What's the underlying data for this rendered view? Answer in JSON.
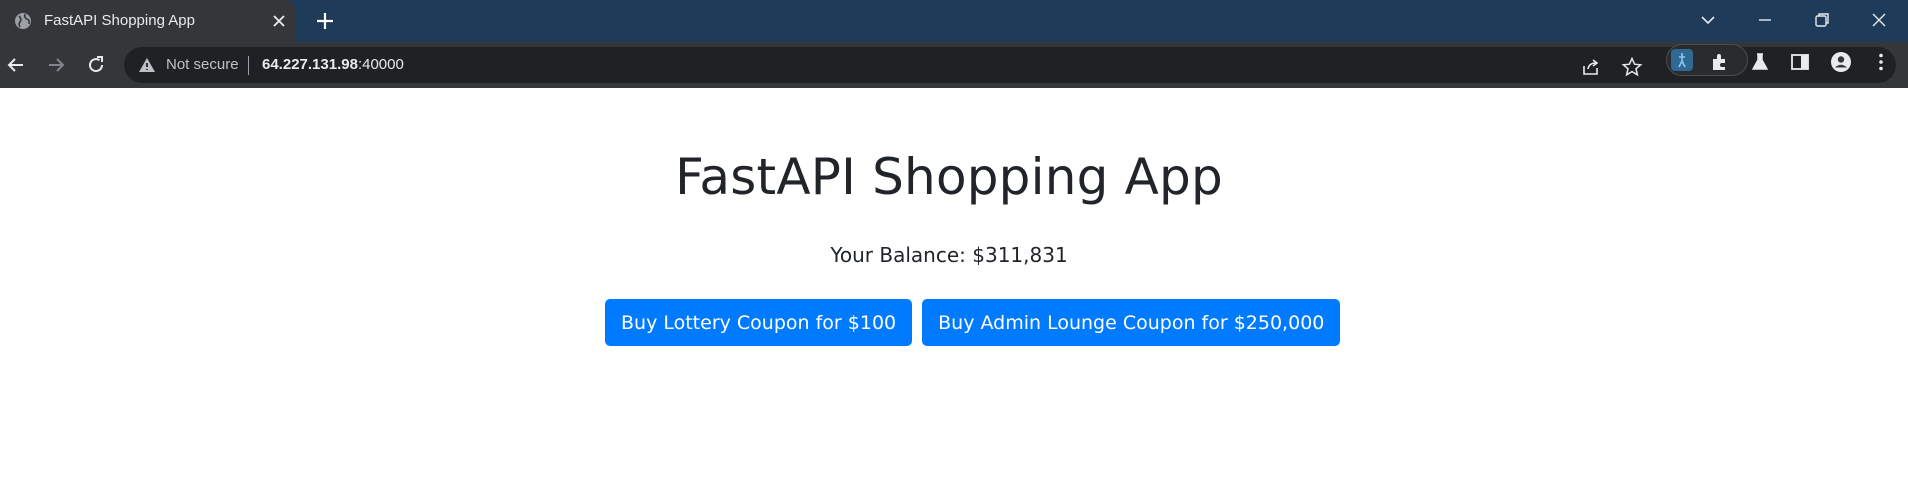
{
  "browser": {
    "tab": {
      "title": "FastAPI Shopping App"
    },
    "address_bar": {
      "security_label": "Not secure",
      "host": "64.227.131.98",
      "port": ":40000"
    },
    "colors": {
      "tabstrip": "#1f3b5a",
      "toolbar": "#35363a",
      "omnibox": "#202124"
    }
  },
  "page": {
    "heading": "FastAPI Shopping App",
    "balance": "Your Balance: $311,831",
    "buttons": [
      {
        "label": "Buy Lottery Coupon for $100"
      },
      {
        "label": "Buy Admin Lounge Coupon for $250,000"
      }
    ],
    "colors": {
      "button": "#007bff",
      "text": "#212529"
    }
  }
}
